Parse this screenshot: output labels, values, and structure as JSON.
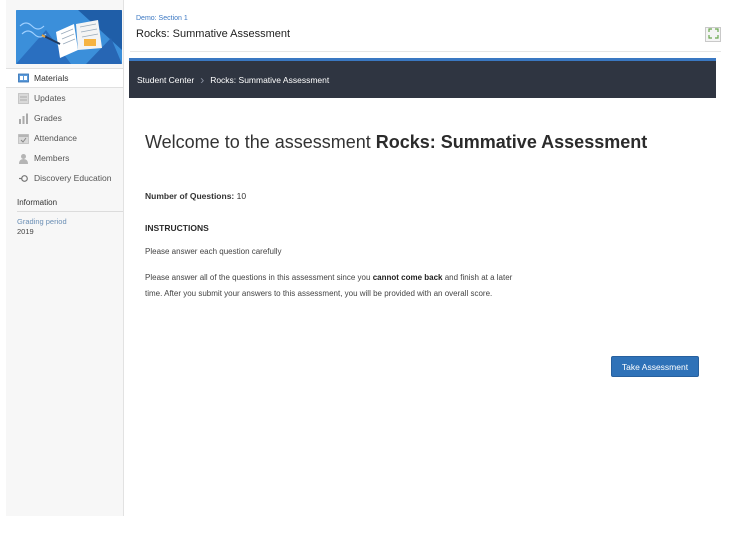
{
  "course": {
    "image_name": "course-notebook-illustration"
  },
  "sidebar": {
    "items": [
      {
        "label": "Materials",
        "icon": "materials-icon",
        "active": true
      },
      {
        "label": "Updates",
        "icon": "updates-icon"
      },
      {
        "label": "Grades",
        "icon": "grades-icon"
      },
      {
        "label": "Attendance",
        "icon": "attendance-icon"
      },
      {
        "label": "Members",
        "icon": "members-icon"
      },
      {
        "label": "Discovery Education",
        "icon": "discovery-icon"
      }
    ],
    "section_title": "Information",
    "grading_period_label": "Grading period",
    "grading_period_value": "2019"
  },
  "header": {
    "breadcrumb": "Demo: Section 1",
    "title": "Rocks: Summative Assessment",
    "fullscreen_icon": "fullscreen-icon"
  },
  "topbar": {
    "student_center": "Student Center",
    "current": "Rocks: Summative Assessment"
  },
  "assessment": {
    "welcome_prefix": "Welcome to the assessment ",
    "welcome_name": "Rocks: Summative Assessment",
    "num_questions_label": "Number of Questions:",
    "num_questions_value": "10",
    "instructions_heading": "INSTRUCTIONS",
    "instruction_1": "Please answer each question carefully",
    "instruction_2_part1": "Please answer all of the questions in this assessment since you ",
    "instruction_2_bold": "cannot come back",
    "instruction_2_part2": " and finish at a later time. After you submit your answers to this assessment, you will be provided with an overall score.",
    "take_button": "Take Assessment"
  },
  "colors": {
    "accent": "#2f72b8",
    "topbar": "#2f3541",
    "link": "#3c78c3"
  }
}
